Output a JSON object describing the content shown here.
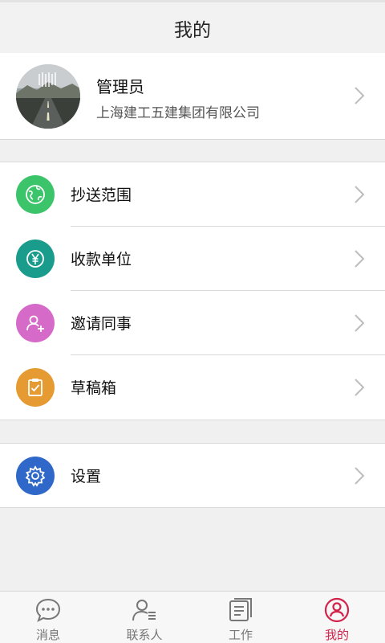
{
  "header": {
    "title": "我的"
  },
  "profile": {
    "name": "管理员",
    "company": "上海建工五建集团有限公司"
  },
  "menu": {
    "items": [
      {
        "label": "抄送范围",
        "icon": "globe-icon",
        "color": "#3cc46a"
      },
      {
        "label": "收款单位",
        "icon": "yen-icon",
        "color": "#1a9c8c"
      },
      {
        "label": "邀请同事",
        "icon": "add-person-icon",
        "color": "#d66ac9"
      },
      {
        "label": "草稿箱",
        "icon": "clipboard-check-icon",
        "color": "#e59a32"
      }
    ],
    "settings": {
      "label": "设置",
      "icon": "gear-icon",
      "color": "#2f68c8"
    }
  },
  "tabbar": {
    "tabs": [
      {
        "label": "消息",
        "icon": "chat-bubble-icon"
      },
      {
        "label": "联系人",
        "icon": "contact-icon"
      },
      {
        "label": "工作",
        "icon": "document-icon"
      },
      {
        "label": "我的",
        "icon": "user-circle-icon",
        "active": true
      }
    ],
    "active_color": "#d3224a"
  }
}
